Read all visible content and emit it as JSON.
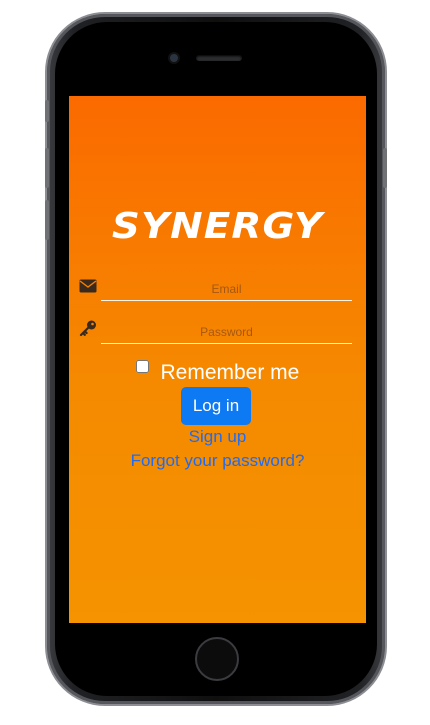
{
  "app": {
    "logo_text": "SYNERGY"
  },
  "form": {
    "email_placeholder": "Email",
    "password_placeholder": "Password",
    "email_icon": "envelope-icon",
    "password_icon": "key-icon",
    "remember_label": "Remember me",
    "remember_checked": false,
    "login_label": "Log in",
    "signup_label": "Sign up",
    "forgot_label": "Forgot your password?"
  },
  "colors": {
    "screen_top": "#fb6a00",
    "screen_bottom": "#f59300",
    "button": "#0d79f2",
    "link": "#1f6bf2"
  }
}
